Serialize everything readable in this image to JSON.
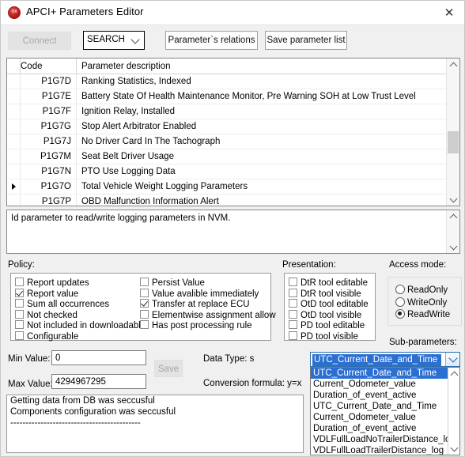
{
  "window": {
    "title": "APCI+ Parameters Editor",
    "close_label": "✕",
    "icon": "app-badge-icon"
  },
  "toolbar": {
    "connect_label": "Connect",
    "search_combo_value": "SEARCH",
    "relations_label": "Parameter`s relations",
    "save_list_label": "Save parameter list"
  },
  "table": {
    "columns": [
      "Code",
      "Parameter description"
    ],
    "rows": [
      {
        "selected": false,
        "code": "P1G7D",
        "description": "Ranking Statistics, Indexed"
      },
      {
        "selected": false,
        "code": "P1G7E",
        "description": "Battery State Of Health Maintenance Monitor, Pre Warning SOH at Low Trust Level"
      },
      {
        "selected": false,
        "code": "P1G7F",
        "description": "Ignition Relay, Installed"
      },
      {
        "selected": false,
        "code": "P1G7G",
        "description": "Stop Alert Arbitrator Enabled"
      },
      {
        "selected": false,
        "code": "P1G7J",
        "description": "No Driver Card In The Tachograph"
      },
      {
        "selected": false,
        "code": "P1G7M",
        "description": "Seat Belt Driver Usage"
      },
      {
        "selected": false,
        "code": "P1G7N",
        "description": "PTO Use Logging Data"
      },
      {
        "selected": true,
        "code": "P1G7O",
        "description": "Total Vehicle Weight Logging Parameters"
      },
      {
        "selected": false,
        "code": "P1G7P",
        "description": "OBD Malfunction Information Alert"
      }
    ]
  },
  "description": {
    "text": "Id parameter to read/write logging parameters in NVM."
  },
  "policy": {
    "label": "Policy:",
    "left_items": [
      {
        "label": "Report updates",
        "checked": false
      },
      {
        "label": "Report value",
        "checked": true
      },
      {
        "label": "Sum all occurrences",
        "checked": false
      },
      {
        "label": "Not checked",
        "checked": false
      },
      {
        "label": "Not included in downloadable",
        "checked": false
      },
      {
        "label": "Configurable",
        "checked": false
      }
    ],
    "right_items": [
      {
        "label": "Persist Value",
        "checked": false
      },
      {
        "label": "Value avalible immediately",
        "checked": false
      },
      {
        "label": "Transfer at replace ECU",
        "checked": true
      },
      {
        "label": "Elementwise assignment allow",
        "checked": false
      },
      {
        "label": "Has post processing rule",
        "checked": false
      }
    ]
  },
  "presentation": {
    "label": "Presentation:",
    "items": [
      {
        "label": "DtR tool editable",
        "checked": false
      },
      {
        "label": "DtR tool visible",
        "checked": false
      },
      {
        "label": "OtD tool editable",
        "checked": false
      },
      {
        "label": "OtD tool visible",
        "checked": false
      },
      {
        "label": "PD tool editable",
        "checked": false
      },
      {
        "label": "PD tool visible",
        "checked": false
      }
    ]
  },
  "access_mode": {
    "label": "Access mode:",
    "options": [
      {
        "label": "ReadOnly",
        "selected": false
      },
      {
        "label": "WriteOnly",
        "selected": false
      },
      {
        "label": "ReadWrite",
        "selected": true
      }
    ]
  },
  "fields": {
    "min_label": "Min Value:",
    "min_value": "0",
    "max_label": "Max Value:",
    "max_value": "4294967295",
    "save_label": "Save",
    "data_type_label": "Data Type: s",
    "conversion_label": "Conversion formula: y=x"
  },
  "subparameters": {
    "label": "Sub-parameters:",
    "selected": "UTC_Current_Date_and_Time",
    "options": [
      "UTC_Current_Date_and_Time",
      "Current_Odometer_value",
      "Duration_of_event_active",
      "UTC_Current_Date_and_Time",
      "Current_Odometer_value",
      "Duration_of_event_active",
      "VDLFullLoadNoTrailerDistance_log",
      "VDLFullLoadTrailerDistance_log"
    ]
  },
  "log": {
    "lines": [
      "Getting data from DB was seccusful",
      "Components configuration was seccusful",
      "-------------------------------------------"
    ]
  },
  "colors": {
    "accent_blue": "#2b6fd1",
    "window_bg": "#f0f0f0",
    "icon_red": "#c01f1f"
  }
}
